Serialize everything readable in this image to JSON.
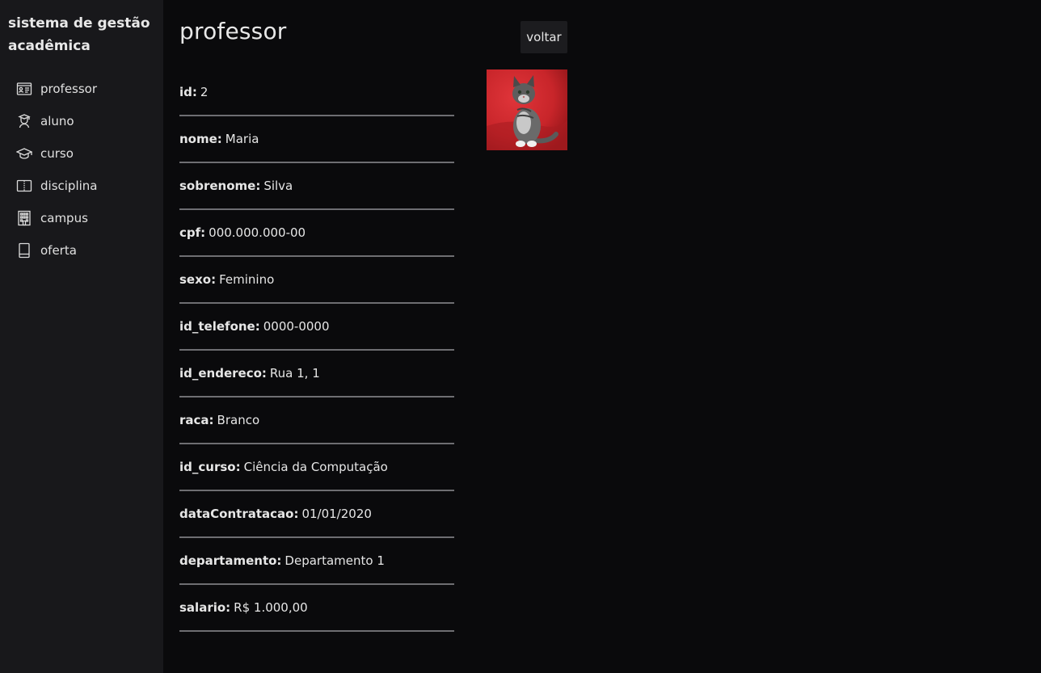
{
  "app": {
    "title": "sistema de gestão acadêmica"
  },
  "nav": {
    "items": [
      {
        "label": "professor",
        "icon": "id-card-icon"
      },
      {
        "label": "aluno",
        "icon": "student-icon"
      },
      {
        "label": "curso",
        "icon": "graduation-cap-icon"
      },
      {
        "label": "disciplina",
        "icon": "open-book-icon"
      },
      {
        "label": "campus",
        "icon": "building-icon"
      },
      {
        "label": "oferta",
        "icon": "book-icon"
      }
    ]
  },
  "page": {
    "title": "professor",
    "back_label": "voltar"
  },
  "record": {
    "fields": [
      {
        "key": "id:",
        "value": "2"
      },
      {
        "key": "nome:",
        "value": "Maria"
      },
      {
        "key": "sobrenome:",
        "value": "Silva"
      },
      {
        "key": "cpf:",
        "value": "000.000.000-00"
      },
      {
        "key": "sexo:",
        "value": "Feminino"
      },
      {
        "key": "id_telefone:",
        "value": "0000-0000"
      },
      {
        "key": "id_endereco:",
        "value": "Rua 1, 1"
      },
      {
        "key": "raca:",
        "value": "Branco"
      },
      {
        "key": "id_curso:",
        "value": "Ciência da Computação"
      },
      {
        "key": "dataContratacao:",
        "value": "01/01/2020"
      },
      {
        "key": "departamento:",
        "value": "Departamento 1"
      },
      {
        "key": "salario:",
        "value": "R$ 1.000,00"
      }
    ]
  },
  "colors": {
    "sidebar_bg": "#18181b",
    "main_bg": "#0a0a0c",
    "divider": "#6e6e72",
    "photo_bg": "#c8252a"
  }
}
